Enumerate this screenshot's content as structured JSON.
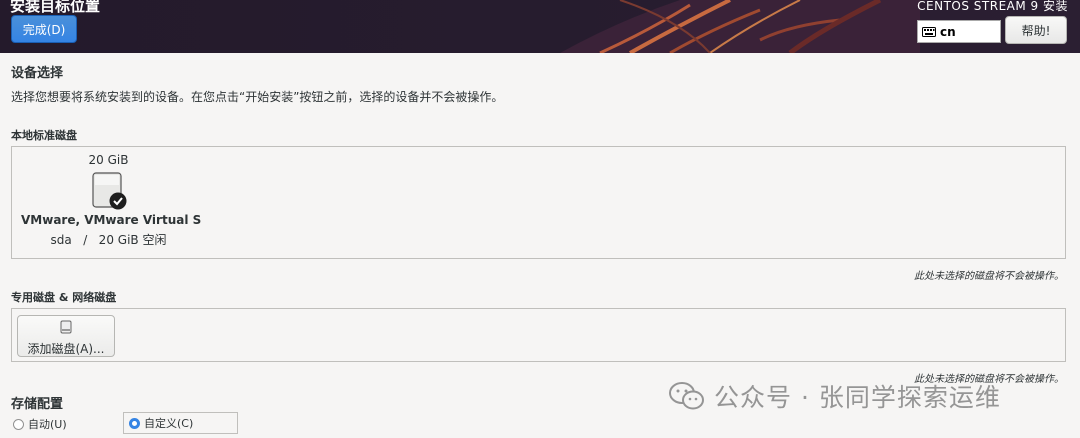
{
  "header": {
    "title": "安装目标位置",
    "done_label": "完成(D)",
    "product": "CENTOS STREAM 9 安装",
    "keyboard_layout": "cn",
    "help_label": "帮助!"
  },
  "device_selection": {
    "heading": "设备选择",
    "description": "选择您想要将系统安装到的设备。在您点击“开始安装”按钮之前，选择的设备并不会被操作。"
  },
  "local_disks": {
    "heading": "本地标准磁盘",
    "disks": [
      {
        "size": "20 GiB",
        "name": "VMware, VMware Virtual S",
        "free": "sda   /   20 GiB 空闲",
        "selected": true
      }
    ],
    "note": "此处未选择的磁盘将不会被操作。"
  },
  "specialized_disks": {
    "heading": "专用磁盘 & 网络磁盘",
    "add_label": "添加磁盘(A)...",
    "note": "此处未选择的磁盘将不会被操作。"
  },
  "storage_config": {
    "heading": "存储配置",
    "options": [
      {
        "label": "自动(U)",
        "selected": false
      },
      {
        "label": "自定义(C)",
        "selected": true
      }
    ]
  },
  "watermark": "公众号 · 张同学探索运维",
  "colors": {
    "accent": "#3584e4",
    "header_bg": "#241a2b"
  }
}
